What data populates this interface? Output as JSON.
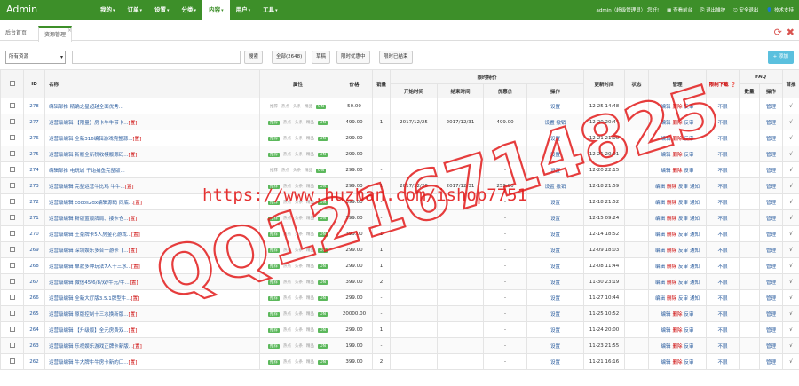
{
  "navbar": {
    "brand": "Admin",
    "menu": [
      {
        "label": "我的",
        "caret": "▾",
        "active": false
      },
      {
        "label": "订单",
        "caret": "▾",
        "active": false
      },
      {
        "label": "设置",
        "caret": "▾",
        "active": false
      },
      {
        "label": "分类",
        "caret": "▾",
        "active": false
      },
      {
        "label": "内容",
        "caret": "▾",
        "active": true
      },
      {
        "label": "用户",
        "caret": "▾",
        "active": false
      },
      {
        "label": "工具",
        "caret": "▾",
        "active": false
      }
    ],
    "user": "admin（超级管理员）",
    "user_suffix": "您好!",
    "links": [
      "▦ 查看前台",
      "⎘ 退出維护",
      "⎋ 安全退出",
      "👤 技术支持"
    ]
  },
  "tabs": {
    "home": "后台首页",
    "current": "资源管理",
    "close": "×"
  },
  "toolbar": {
    "type_select": "所有资源",
    "search_button": "搜索",
    "all_button": "全部(2648)",
    "draft_button": "草稿",
    "promo_button": "限时优惠中",
    "promo_end_button": "限时已结束",
    "add_button": "+ 添加"
  },
  "table": {
    "headers": {
      "id": "ID",
      "name": "名称",
      "attrs": "属性",
      "price": "价格",
      "stock": "销量",
      "promo": "限时特价",
      "promo_start": "开始时间",
      "promo_end": "结束时间",
      "promo_price": "优惠价",
      "promo_op": "操作",
      "updated": "更新时间",
      "status": "状态",
      "manage": "管理",
      "limited": "限制下载 ❓",
      "faq": "FAQ",
      "faq_count": "数量",
      "faq_op": "操作",
      "on": "首推"
    },
    "attr_labels": [
      "推荐",
      "热点",
      "头条",
      "精品",
      "ON"
    ],
    "rows": [
      {
        "id": "278",
        "name": "编辑部推 精确之星超越全面优秀...",
        "flag": "",
        "attrs": [
          0,
          0,
          0,
          0,
          1
        ],
        "price": "50.00",
        "sales": "-",
        "pstart": "",
        "pend": "",
        "pprice": "",
        "pop": "设置",
        "updated": "12-25 14:48",
        "status": "",
        "manage": [
          "编辑",
          "删除",
          "反审"
        ],
        "limit": "不限",
        "faq_n": "",
        "faq_op": "管理",
        "on": "√"
      },
      {
        "id": "277",
        "name": "运营级编辑 【限量】房卡牛牛带卡...",
        "flag": "[置]",
        "attrs": [
          1,
          0,
          0,
          0,
          1
        ],
        "price": "499.00",
        "sales": "1",
        "pstart": "2017/12/25",
        "pend": "2017/12/31",
        "pprice": "499.00",
        "pop": "设置 撤销",
        "updated": "12-20 20:44",
        "status": "",
        "manage": [
          "编辑",
          "删除",
          "反审"
        ],
        "limit": "不限",
        "faq_n": "",
        "faq_op": "管理",
        "on": "√"
      },
      {
        "id": "276",
        "name": "运营级编辑 全新316编辑游戏完整源...",
        "flag": "[置]",
        "attrs": [
          1,
          0,
          0,
          0,
          1
        ],
        "price": "299.00",
        "sales": "-",
        "pstart": "",
        "pend": "",
        "pprice": "-",
        "pop": "设置",
        "updated": "12-21 21:00",
        "status": "",
        "manage": [
          "编辑",
          "删除",
          "反审"
        ],
        "limit": "不限",
        "faq_n": "",
        "faq_op": "管理",
        "on": "√"
      },
      {
        "id": "275",
        "name": "运营级编辑 新版全新税收模版源码...",
        "flag": "[置]",
        "attrs": [
          1,
          0,
          0,
          0,
          1
        ],
        "price": "299.00",
        "sales": "-",
        "pstart": "",
        "pend": "",
        "pprice": "-",
        "pop": "设置",
        "updated": "12-21 20:01",
        "status": "",
        "manage": [
          "编辑",
          "删除",
          "反审"
        ],
        "limit": "不限",
        "faq_n": "",
        "faq_op": "管理",
        "on": "√"
      },
      {
        "id": "274",
        "name": "编辑部推 电玩城 千炮捕鱼完整版...",
        "flag": "",
        "attrs": [
          0,
          0,
          0,
          0,
          1
        ],
        "price": "299.00",
        "sales": "-",
        "pstart": "",
        "pend": "",
        "pprice": "-",
        "pop": "设置",
        "updated": "12-20 22:15",
        "status": "",
        "manage": [
          "编辑",
          "删除",
          "反审"
        ],
        "limit": "不限",
        "faq_n": "",
        "faq_op": "管理",
        "on": "√"
      },
      {
        "id": "273",
        "name": "运营级编辑 完整运营牛比鸡 牛牛...",
        "flag": "[置]",
        "attrs": [
          1,
          0,
          0,
          0,
          1
        ],
        "price": "299.00",
        "sales": "1",
        "pstart": "2017/12/20",
        "pend": "2017/12/31",
        "pprice": "259.00",
        "pop": "设置 撤销",
        "updated": "12-18 21:59",
        "status": "",
        "manage": [
          "编辑",
          "删除",
          "反审",
          "通知"
        ],
        "limit": "不限",
        "faq_n": "",
        "faq_op": "管理",
        "on": "√"
      },
      {
        "id": "272",
        "name": "运营级编辑 cocos2dx编辑源码 同底...",
        "flag": "[置]",
        "attrs": [
          1,
          0,
          0,
          0,
          1
        ],
        "price": "399.00",
        "sales": "-",
        "pstart": "",
        "pend": "",
        "pprice": "-",
        "pop": "设置",
        "updated": "12-18 21:52",
        "status": "",
        "manage": [
          "编辑",
          "删除",
          "反审",
          "通知"
        ],
        "limit": "不限",
        "faq_n": "",
        "faq_op": "管理",
        "on": "√"
      },
      {
        "id": "271",
        "name": "运营级编辑 新版蓝版牌局、接卡仓...",
        "flag": "[置]",
        "attrs": [
          1,
          0,
          0,
          0,
          1
        ],
        "price": "399.00",
        "sales": "-",
        "pstart": "",
        "pend": "",
        "pprice": "-",
        "pop": "设置",
        "updated": "12-15 09:24",
        "status": "",
        "manage": [
          "编辑",
          "删除",
          "反审",
          "通知"
        ],
        "limit": "不限",
        "faq_n": "",
        "faq_op": "管理",
        "on": "√"
      },
      {
        "id": "270",
        "name": "运营级编辑 土豪牌卡5人房金花游戏...",
        "flag": "[置]",
        "attrs": [
          1,
          0,
          0,
          0,
          1
        ],
        "price": "399.00",
        "sales": "1",
        "pstart": "",
        "pend": "",
        "pprice": "-",
        "pop": "设置",
        "updated": "12-14 18:52",
        "status": "",
        "manage": [
          "编辑",
          "删除",
          "反审",
          "通知"
        ],
        "limit": "不限",
        "faq_n": "",
        "faq_op": "管理",
        "on": "√"
      },
      {
        "id": "269",
        "name": "运营级编辑 深圳娱乐多合一游卡【...",
        "flag": "[置]",
        "attrs": [
          1,
          0,
          0,
          0,
          1
        ],
        "price": "299.00",
        "sales": "1",
        "pstart": "",
        "pend": "",
        "pprice": "-",
        "pop": "设置",
        "updated": "12-09 18:03",
        "status": "",
        "manage": [
          "编辑",
          "删除",
          "反审",
          "通知"
        ],
        "limit": "不限",
        "faq_n": "",
        "faq_op": "管理",
        "on": "√"
      },
      {
        "id": "268",
        "name": "运营级编辑 单款多种玩法7人十三水...",
        "flag": "[置]",
        "attrs": [
          1,
          0,
          0,
          0,
          1
        ],
        "price": "299.00",
        "sales": "1",
        "pstart": "",
        "pend": "",
        "pprice": "-",
        "pop": "设置",
        "updated": "12-08 11:44",
        "status": "",
        "manage": [
          "编辑",
          "删除",
          "反审",
          "通知"
        ],
        "limit": "不限",
        "faq_n": "",
        "faq_op": "管理",
        "on": "√"
      },
      {
        "id": "267",
        "name": "运营级编辑 微信45/6/8/双/牛元/牛...",
        "flag": "[置]",
        "attrs": [
          1,
          0,
          0,
          0,
          1
        ],
        "price": "399.00",
        "sales": "2",
        "pstart": "",
        "pend": "",
        "pprice": "-",
        "pop": "设置",
        "updated": "11-30 23:19",
        "status": "",
        "manage": [
          "编辑",
          "删除",
          "反审",
          "通知"
        ],
        "limit": "不限",
        "faq_n": "",
        "faq_op": "管理",
        "on": "√"
      },
      {
        "id": "266",
        "name": "运营级编辑 全新大厅版3.5.1牌型牛...",
        "flag": "[置]",
        "attrs": [
          1,
          0,
          0,
          0,
          1
        ],
        "price": "299.00",
        "sales": "-",
        "pstart": "",
        "pend": "",
        "pprice": "-",
        "pop": "设置",
        "updated": "11-27 10:44",
        "status": "",
        "manage": [
          "编辑",
          "删除",
          "反审",
          "通知"
        ],
        "limit": "不限",
        "faq_n": "",
        "faq_op": "管理",
        "on": "√"
      },
      {
        "id": "265",
        "name": "运营级编辑 原版控制十三水换新版...",
        "flag": "[置]",
        "attrs": [
          1,
          0,
          0,
          0,
          1
        ],
        "price": "20000.00",
        "sales": "-",
        "pstart": "",
        "pend": "",
        "pprice": "-",
        "pop": "设置",
        "updated": "11-25 10:52",
        "status": "",
        "manage": [
          "编辑",
          "删除",
          "反审"
        ],
        "limit": "不限",
        "faq_n": "",
        "faq_op": "管理",
        "on": "√"
      },
      {
        "id": "264",
        "name": "运营级编辑 【升级版】全元房费双...",
        "flag": "[置]",
        "attrs": [
          1,
          0,
          0,
          0,
          1
        ],
        "price": "299.00",
        "sales": "1",
        "pstart": "",
        "pend": "",
        "pprice": "-",
        "pop": "设置",
        "updated": "11-24 20:00",
        "status": "",
        "manage": [
          "编辑",
          "删除",
          "反审"
        ],
        "limit": "不限",
        "faq_n": "",
        "faq_op": "管理",
        "on": "√"
      },
      {
        "id": "263",
        "name": "运营级编辑 乐视娱乐游戏正牌卡新版...",
        "flag": "[置]",
        "attrs": [
          1,
          0,
          0,
          0,
          1
        ],
        "price": "199.00",
        "sales": "-",
        "pstart": "",
        "pend": "",
        "pprice": "-",
        "pop": "设置",
        "updated": "11-23 21:55",
        "status": "",
        "manage": [
          "编辑",
          "删除",
          "反审"
        ],
        "limit": "不限",
        "faq_n": "",
        "faq_op": "管理",
        "on": "√"
      },
      {
        "id": "262",
        "name": "运营级编辑 牛大牌牛牛房卡新的口...",
        "flag": "[置]",
        "attrs": [
          1,
          0,
          0,
          0,
          1
        ],
        "price": "399.00",
        "sales": "2",
        "pstart": "",
        "pend": "",
        "pprice": "-",
        "pop": "设置",
        "updated": "11-21 16:16",
        "status": "",
        "manage": [
          "编辑",
          "删除",
          "反审"
        ],
        "limit": "不限",
        "faq_n": "",
        "faq_op": "管理",
        "on": "√"
      }
    ]
  },
  "watermark": {
    "url": "https://www.huzhan.com/ishop7751",
    "qq": "QQ1216714825"
  },
  "colors": {
    "nav": "#3d8f29",
    "link": "#2a5c9e",
    "danger": "#c00",
    "tag": "#5cb85c",
    "watermark": "#e21b1b"
  }
}
